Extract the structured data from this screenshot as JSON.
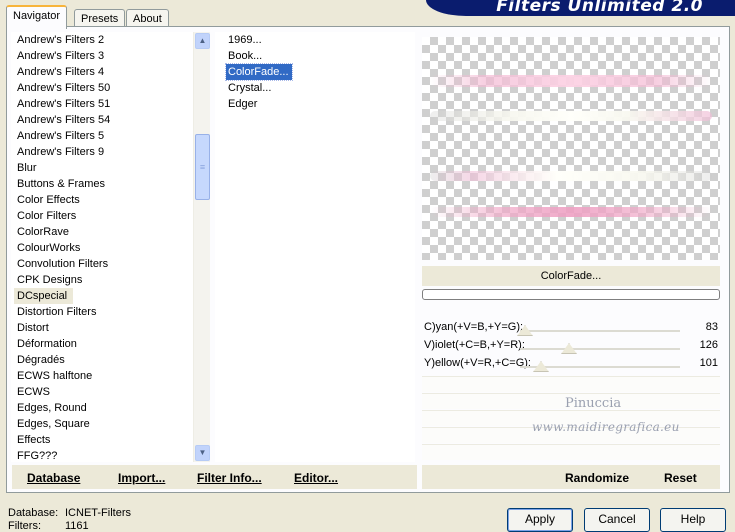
{
  "tabs": [
    {
      "label": "Navigator",
      "active": true
    },
    {
      "label": "Presets",
      "active": false
    },
    {
      "label": "About",
      "active": false
    }
  ],
  "banner_title": "Filters Unlimited 2.0",
  "categories": [
    "Andrew's Filters 2",
    "Andrew's Filters 3",
    "Andrew's Filters 4",
    "Andrew's Filters 50",
    "Andrew's Filters 51",
    "Andrew's Filters 54",
    "Andrew's Filters 5",
    "Andrew's Filters 9",
    "Blur",
    "Buttons & Frames",
    "Color Effects",
    "Color Filters",
    "ColorRave",
    "ColourWorks",
    "Convolution Filters",
    "CPK Designs",
    "DCspecial",
    "Distortion Filters",
    "Distort",
    "Déformation",
    "Dégradés",
    "ECWS halftone",
    "ECWS",
    "Edges, Round",
    "Edges, Square",
    "Effects",
    "FFG???"
  ],
  "selected_category": "DCspecial",
  "filters": [
    "1969...",
    "Book...",
    "ColorFade...",
    "Crystal...",
    "Edger"
  ],
  "selected_filter": "ColorFade...",
  "preview": {
    "label": "ColorFade...",
    "progress": 0
  },
  "params": [
    {
      "label": "C)yan(+V=B,+Y=G):",
      "value": "83"
    },
    {
      "label": "V)iolet(+C=B,+Y=R):",
      "value": "126"
    },
    {
      "label": "Y)ellow(+V=R,+C=G):",
      "value": "101"
    }
  ],
  "watermark": {
    "line1": "Pinuccia",
    "line2": "www.maidiregrafica.eu"
  },
  "bottom_buttons": {
    "database": "Database",
    "import": "Import...",
    "filter_info": "Filter Info...",
    "editor": "Editor...",
    "randomize": "Randomize",
    "reset": "Reset"
  },
  "status": {
    "database_label": "Database:",
    "database_value": "ICNET-Filters",
    "filters_label": "Filters:",
    "filters_value": "1161"
  },
  "dialog": {
    "apply": "Apply",
    "cancel": "Cancel",
    "help": "Help"
  },
  "colors": {
    "selection": "#316ac5",
    "banner": "#0a1c6e",
    "pink_stripe": "#f3b9d3"
  }
}
